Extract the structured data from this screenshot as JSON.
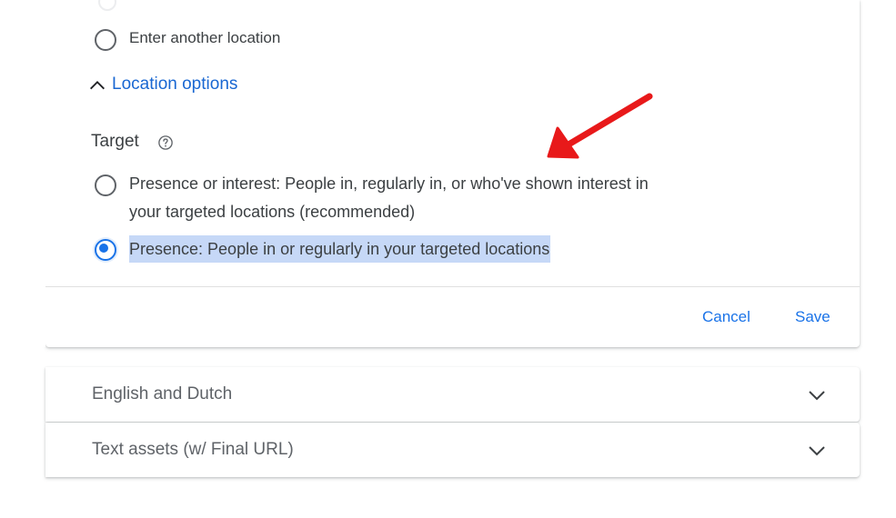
{
  "location": {
    "another_location_label": "Enter another location",
    "options_toggle_label": "Location options",
    "target_label": "Target",
    "options": [
      {
        "line1": "Presence or interest: People in, regularly in, or who've shown interest in",
        "line2": "your targeted locations (recommended)",
        "selected": false
      },
      {
        "line1": "Presence: People in or regularly in your targeted locations",
        "selected": true
      }
    ]
  },
  "actions": {
    "cancel_label": "Cancel",
    "save_label": "Save"
  },
  "panels": [
    {
      "label": "English and Dutch"
    },
    {
      "label": "Text assets (w/ Final URL)"
    }
  ],
  "colors": {
    "accent": "#1a73e8",
    "link": "#1967d2",
    "selection": "#c6d8f7",
    "annotation_arrow": "#e8191a"
  },
  "icons": {
    "help": "help-circle-icon",
    "chevron_up": "chevron-up-icon",
    "chevron_down": "chevron-down-icon",
    "annotation": "red-arrow-annotation"
  }
}
